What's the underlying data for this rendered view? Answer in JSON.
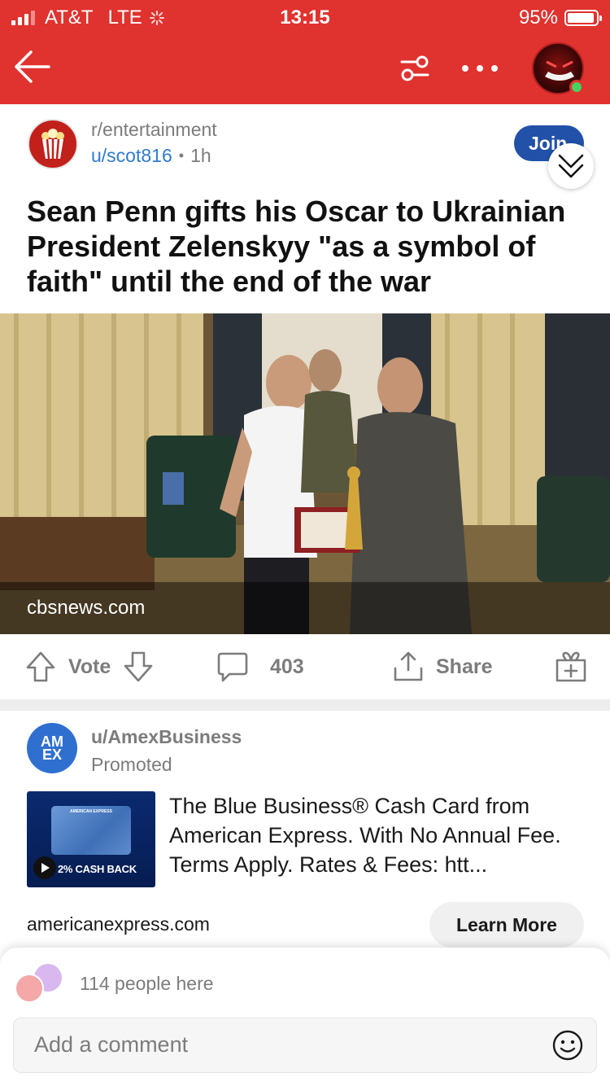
{
  "status_bar": {
    "carrier": "AT&T",
    "network": "LTE",
    "time": "13:15",
    "battery": "95%",
    "battery_level": 0.95
  },
  "nav": {
    "icons": [
      "back-arrow-icon",
      "filter-icon",
      "more-icon",
      "user-avatar"
    ]
  },
  "post": {
    "subreddit": "r/entertainment",
    "author": "u/scot816",
    "separator": "•",
    "age": "1h",
    "join_label": "Join",
    "title": "Sean Penn gifts his Oscar to Ukrainian President Zelenskyy \"as a symbol of faith\" until the end of the war",
    "source": "cbsnews.com"
  },
  "actions": {
    "vote_label": "Vote",
    "comments_count": "403",
    "share_label": "Share"
  },
  "promoted": {
    "logo_text": "AM EX",
    "user": "u/AmexBusiness",
    "tag": "Promoted",
    "thumb_card_label": "AMERICAN EXPRESS",
    "thumb_cash_back": "2% CASH BACK",
    "text": "The Blue Business® Cash Card from American Express. With No Annual Fee. Terms Apply. Rates & Fees: htt...",
    "domain": "americanexpress.com",
    "cta": "Learn More"
  },
  "comment_sheet": {
    "people_here": "114 people here",
    "placeholder": "Add a comment"
  },
  "colors": {
    "brand_red": "#e0322e",
    "link_blue": "#2e7bcf",
    "join_blue": "#2151a8"
  }
}
